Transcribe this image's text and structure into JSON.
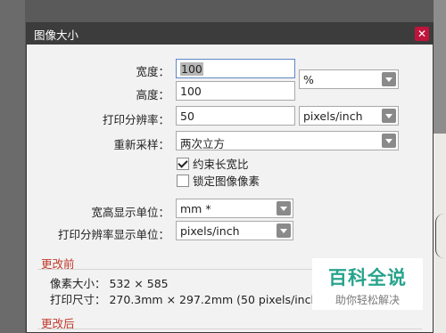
{
  "dialog": {
    "title": "图像大小",
    "close_icon": "close-icon"
  },
  "size": {
    "width_label": "宽度：",
    "width_value": "100",
    "height_label": "高度：",
    "height_value": "100",
    "unit_value": "%",
    "resolution_label": "打印分辨率：",
    "resolution_value": "50",
    "resolution_unit": "pixels/inch",
    "resample_label": "重新采样：",
    "resample_value": "两次立方",
    "constrain_label": "约束长宽比",
    "constrain_checked": true,
    "lock_label": "锁定图像像素",
    "lock_checked": false,
    "display_unit_label": "宽高显示单位：",
    "display_unit_value": "mm *",
    "display_res_label": "打印分辨率显示单位：",
    "display_res_value": "pixels/inch"
  },
  "before": {
    "title": "更改前",
    "pixel_size": "像素大小：  532 × 585",
    "print_size": "打印尺寸：  270.3mm × 297.2mm (50 pixels/inch)"
  },
  "after": {
    "title": "更改后"
  },
  "watermark": {
    "big": "百科全说",
    "small": "助你轻松解决"
  }
}
